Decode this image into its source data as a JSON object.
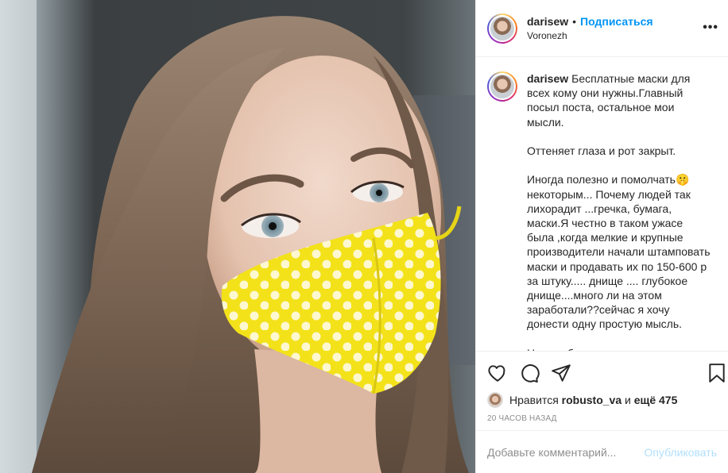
{
  "post": {
    "author": {
      "username": "darisew",
      "location": "Voronezh",
      "follow_label": "Подписаться",
      "separator": "•"
    },
    "more_icon": "more-horizontal-icon",
    "more_label": "•••",
    "caption": {
      "username": "darisew",
      "text": "Бесплатные маски для всех кому они нужны.Главный посыл поста, остальное мои мысли.\n\nОттеняет глаза и рот закрыт.\n\nИногда полезно и помолчать🤫 некоторым... Почему людей так лихорадит ...гречка, бумага, маски.Я честно в таком ужасе была ,когда мелкие и крупные производители начали штамповать маски и продавать их по 150-600 р за штуку..... днище .... глубокое днище....много ли на этом заработали??сейчас я хочу донести одну простую мысль.\n\nНельзя брать деньги за то, что ты"
    },
    "actions": {
      "like_icon": "heart-icon",
      "comment_icon": "comment-icon",
      "share_icon": "send-icon",
      "save_icon": "bookmark-icon"
    },
    "likes": {
      "prefix": "Нравится",
      "user": "robusto_va",
      "middle": "и",
      "count_text": "ещё 475"
    },
    "timestamp": "20 часов назад",
    "comment": {
      "placeholder": "Добавьте комментарий...",
      "publish_label": "Опубликовать"
    },
    "colors": {
      "link_blue": "#0095f6",
      "publish_disabled": "#b2dffc",
      "mask_yellow": "#f3e21a"
    }
  }
}
